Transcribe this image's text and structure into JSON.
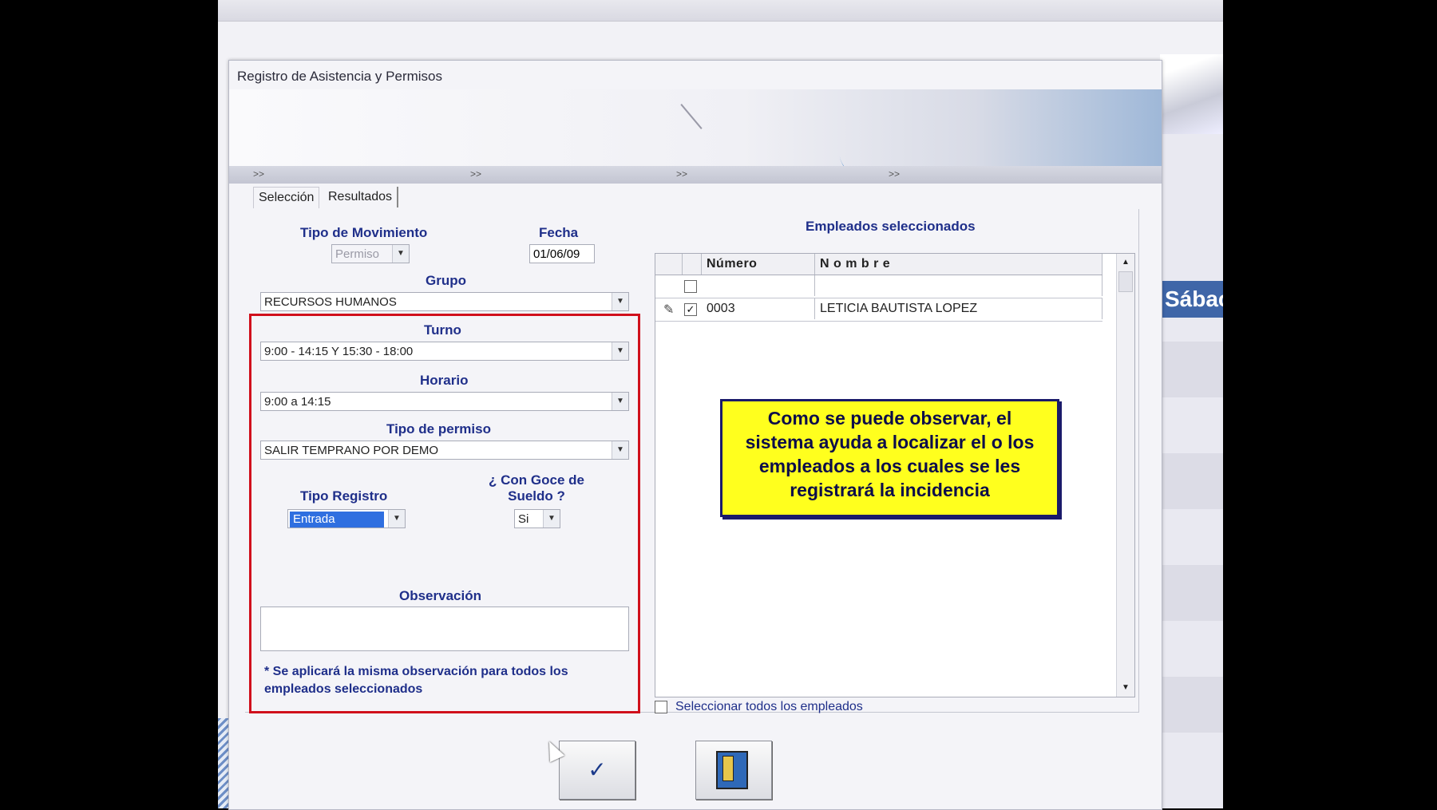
{
  "dialog": {
    "title": "Registro de Asistencia y Permisos"
  },
  "background": {
    "right_label": "Sábac"
  },
  "nav_arrows": [
    ">>",
    ">>",
    ">>",
    ">>"
  ],
  "tabs": [
    {
      "label": "Selección"
    },
    {
      "label": "Resultados"
    }
  ],
  "form": {
    "tipo_movimiento": {
      "label": "Tipo de Movimiento",
      "value": "Permiso"
    },
    "fecha": {
      "label": "Fecha",
      "value": "01/06/09"
    },
    "grupo": {
      "label": "Grupo",
      "value": "RECURSOS HUMANOS"
    },
    "turno": {
      "label": "Turno",
      "value": "9:00 - 14:15 Y 15:30 - 18:00"
    },
    "horario": {
      "label": "Horario",
      "value": "9:00 a 14:15"
    },
    "tipo_permiso": {
      "label": "Tipo de permiso",
      "value": "SALIR TEMPRANO POR DEMO"
    },
    "tipo_registro": {
      "label": "Tipo Registro",
      "value": "Entrada"
    },
    "goce_sueldo": {
      "label_line1": "¿ Con Goce de",
      "label_line2": "Sueldo ?",
      "value": "Si"
    },
    "observacion": {
      "label": "Observación",
      "value": ""
    },
    "note_line1": "* Se aplicará la misma observación para todos los",
    "note_line2": "empleados seleccionados"
  },
  "employees": {
    "title": "Empleados seleccionados",
    "columns": [
      "Número",
      "N o m b r e"
    ],
    "rows": [
      {
        "numero": "",
        "nombre": "",
        "checked": false
      },
      {
        "numero": "0003",
        "nombre": "LETICIA BAUTISTA LOPEZ",
        "checked": true
      }
    ],
    "select_all_label": "Seleccionar todos los empleados"
  },
  "callout": {
    "line1": "Como se puede observar, el",
    "line2": "sistema ayuda a localizar el o los",
    "line3": "empleados a los cuales se les",
    "line4": "registrará la incidencia"
  },
  "buttons": {
    "ok_glyph": "✓"
  },
  "colors": {
    "label_blue": "#1f2f8a",
    "highlight_red": "#d0101c",
    "callout_yellow": "#ffff1e",
    "selection_blue": "#2f6fe0"
  }
}
